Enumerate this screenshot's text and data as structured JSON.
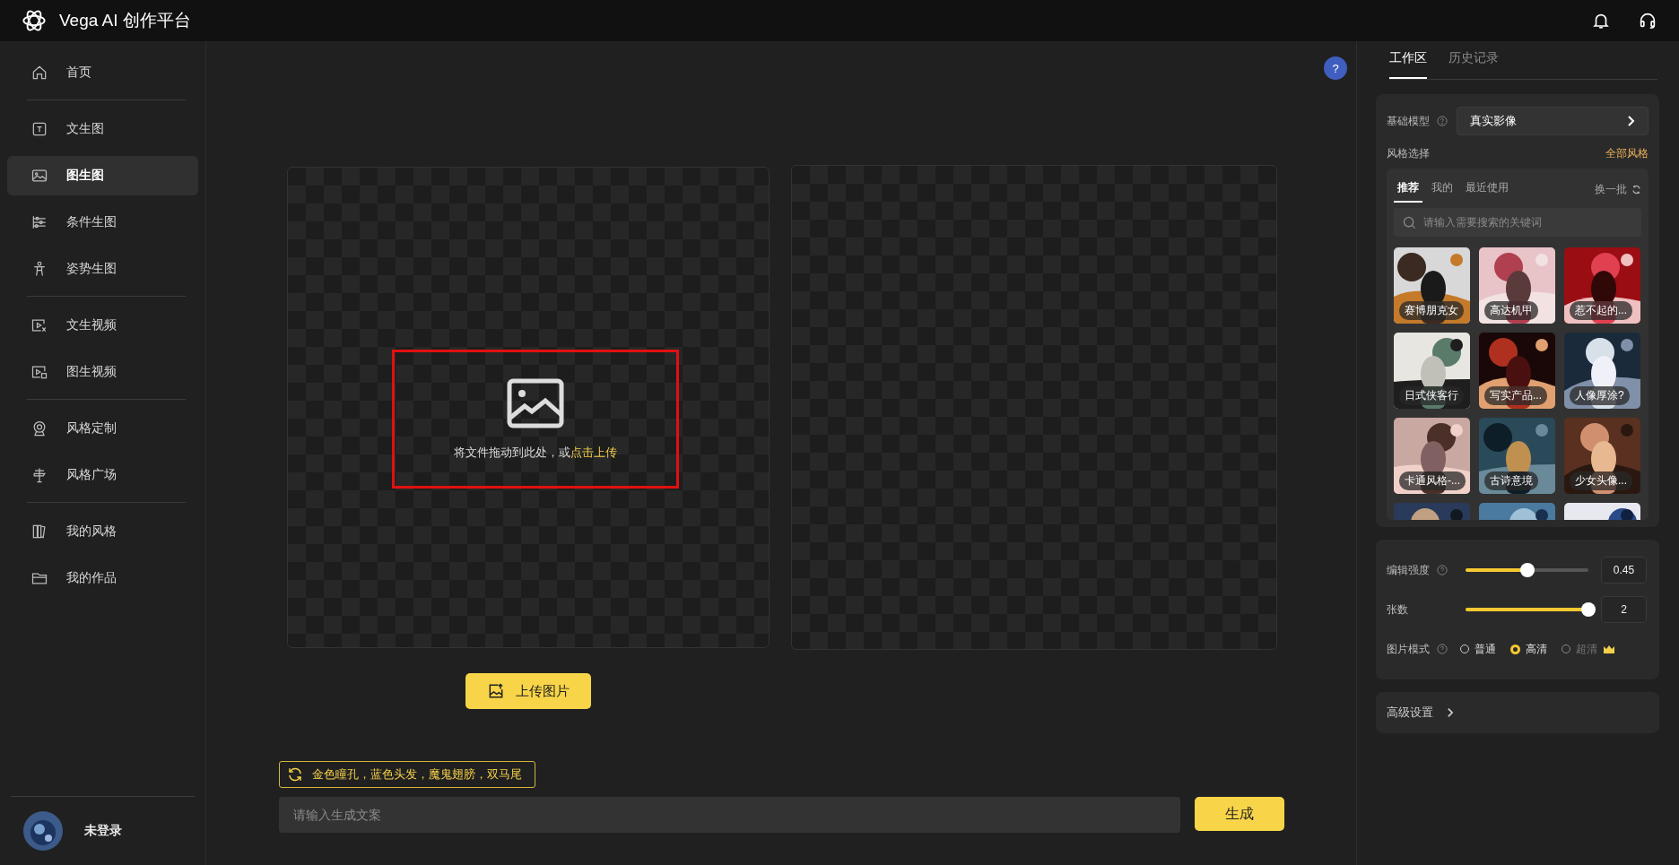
{
  "header": {
    "title": "Vega AI 创作平台"
  },
  "sidebar": {
    "groups": [
      [
        {
          "label": "首页",
          "selected": false
        }
      ],
      [
        {
          "label": "文生图",
          "selected": false
        },
        {
          "label": "图生图",
          "selected": true
        },
        {
          "label": "条件生图",
          "selected": false
        },
        {
          "label": "姿势生图",
          "selected": false
        }
      ],
      [
        {
          "label": "文生视频",
          "selected": false
        },
        {
          "label": "图生视频",
          "selected": false
        }
      ],
      [
        {
          "label": "风格定制",
          "selected": false
        },
        {
          "label": "风格广场",
          "selected": false
        }
      ],
      [
        {
          "label": "我的风格",
          "selected": false
        },
        {
          "label": "我的作品",
          "selected": false
        }
      ]
    ],
    "user": {
      "name": "未登录"
    }
  },
  "help": {
    "label": "?"
  },
  "upload_area": {
    "hint": "将文件拖动到此处，或",
    "link": "点击上传"
  },
  "upload_button": {
    "label": "上传图片"
  },
  "prompt_suggestion": {
    "text": "金色瞳孔，蓝色头发，魔鬼翅膀，双马尾"
  },
  "prompt": {
    "placeholder": "请输入生成文案"
  },
  "generate_button": {
    "label": "生成"
  },
  "panel": {
    "tabs": [
      {
        "label": "工作区",
        "selected": true
      },
      {
        "label": "历史记录",
        "selected": false
      }
    ],
    "base_model": {
      "label": "基础模型",
      "value": "真实影像"
    },
    "style": {
      "label": "风格选择",
      "all_link": "全部风格",
      "tabs": [
        {
          "label": "推荐",
          "selected": true
        },
        {
          "label": "我的",
          "selected": false
        },
        {
          "label": "最近使用",
          "selected": false
        }
      ],
      "refresh": "换一批",
      "search_placeholder": "请输入需要搜索的关键词",
      "items": [
        {
          "label": "赛博朋克女"
        },
        {
          "label": "高达机甲"
        },
        {
          "label": "惹不起的..."
        },
        {
          "label": "日式侠客行"
        },
        {
          "label": "写实产品..."
        },
        {
          "label": "人像厚涂?"
        },
        {
          "label": "卡通风格-..."
        },
        {
          "label": "古诗意境"
        },
        {
          "label": "少女头像..."
        }
      ]
    },
    "sliders": [
      {
        "label": "编辑强度",
        "help": true,
        "level": 0.5,
        "value": "0.45"
      },
      {
        "label": "张数",
        "help": false,
        "level": 1,
        "value": "2"
      }
    ],
    "image_mode": {
      "label": "图片模式",
      "options": [
        {
          "label": "普通",
          "selected": false,
          "disabled": false,
          "premium": false
        },
        {
          "label": "高清",
          "selected": true,
          "disabled": false,
          "premium": false
        },
        {
          "label": "超清",
          "selected": false,
          "disabled": true,
          "premium": true
        }
      ]
    },
    "advanced": {
      "label": "高级设置"
    }
  }
}
